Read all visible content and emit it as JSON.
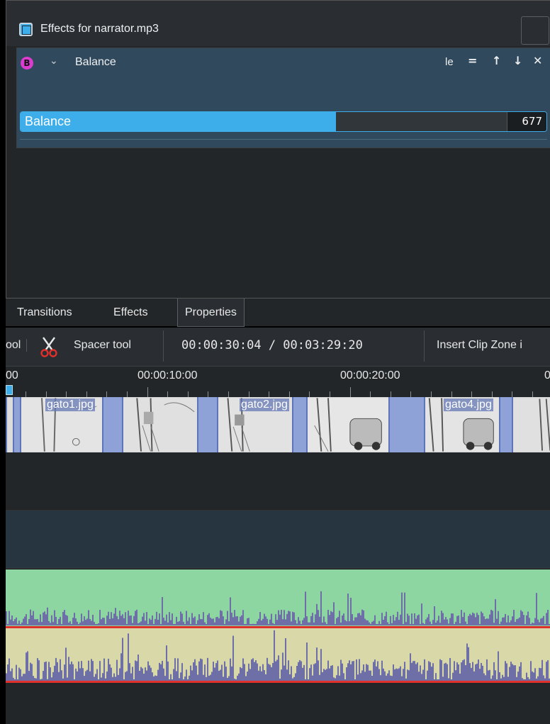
{
  "effects_panel": {
    "title": "Effects for narrator.mp3",
    "effect": {
      "badge": "B",
      "chevron": "⌄",
      "name": "Balance",
      "label_tool": "le",
      "toolbar_icons": [
        "=",
        "↑",
        "↓",
        "✕"
      ]
    },
    "balance": {
      "label": "Balance",
      "value": "677",
      "fill_fraction": 0.6
    }
  },
  "tabs": [
    {
      "label": "Transitions"
    },
    {
      "label": "Effects"
    },
    {
      "label": "Properties",
      "active": true
    }
  ],
  "toolbar": {
    "partial_tool": "ool",
    "spacer_tool": "Spacer tool",
    "timecode": "00:00:30:04 / 00:03:29:20",
    "insert_clip_zone": "Insert Clip Zone i"
  },
  "ruler": {
    "labels": [
      "00",
      "00:00:10:00",
      "00:00:20:00",
      "0"
    ]
  },
  "clips": [
    {
      "label": "gato1.jpg"
    },
    {
      "label": "gato2.jpg"
    },
    {
      "label": "gato4.jpg"
    }
  ],
  "colors": {
    "accent": "#3daee9",
    "audio_green": "#8dd6a2",
    "audio_yellow": "#d8d8a8",
    "audio_selected_border": "#e0302c",
    "video_clip": "#8fa2d8"
  }
}
